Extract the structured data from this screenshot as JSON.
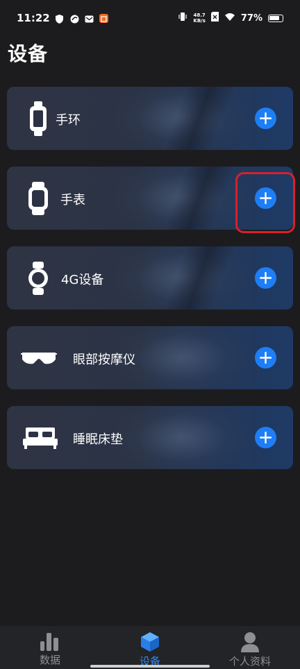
{
  "status_bar": {
    "time": "11:22",
    "net_speed_value": "48.7",
    "net_speed_unit": "KB/s",
    "battery": "77%"
  },
  "page": {
    "title": "设备"
  },
  "devices": [
    {
      "label": "手环",
      "icon": "band-icon"
    },
    {
      "label": "手表",
      "icon": "watch-icon"
    },
    {
      "label": "4G设备",
      "icon": "round-watch-icon"
    },
    {
      "label": "眼部按摩仪",
      "icon": "eye-mask-icon"
    },
    {
      "label": "睡眠床垫",
      "icon": "bed-icon"
    }
  ],
  "tabs": [
    {
      "label": "数据",
      "icon": "bar-chart-icon",
      "active": false
    },
    {
      "label": "设备",
      "icon": "cube-icon",
      "active": true
    },
    {
      "label": "个人资料",
      "icon": "person-icon",
      "active": false
    }
  ],
  "colors": {
    "accent": "#1e7ef5",
    "active_tab": "#2f8cf5",
    "highlight": "#d8202c",
    "background": "#1c1c1e"
  }
}
